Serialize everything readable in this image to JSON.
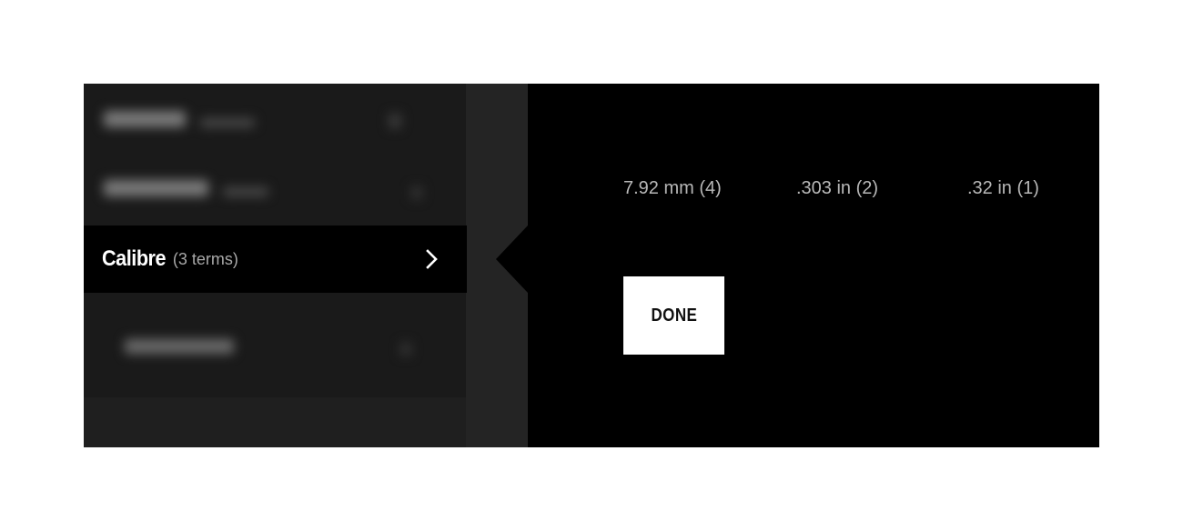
{
  "filter_panel": {
    "active_filter": {
      "label": "Calibre",
      "count": "(3 terms)"
    }
  },
  "options": [
    {
      "label": "7.92 mm (4)"
    },
    {
      "label": ".303 in (2)"
    },
    {
      "label": ".32 in (1)"
    }
  ],
  "actions": {
    "done_label": "DONE"
  },
  "colors": {
    "background": "#000000",
    "panel": "#1a1a1a",
    "option_text": "#b8b8b8",
    "button_bg": "#ffffff"
  }
}
